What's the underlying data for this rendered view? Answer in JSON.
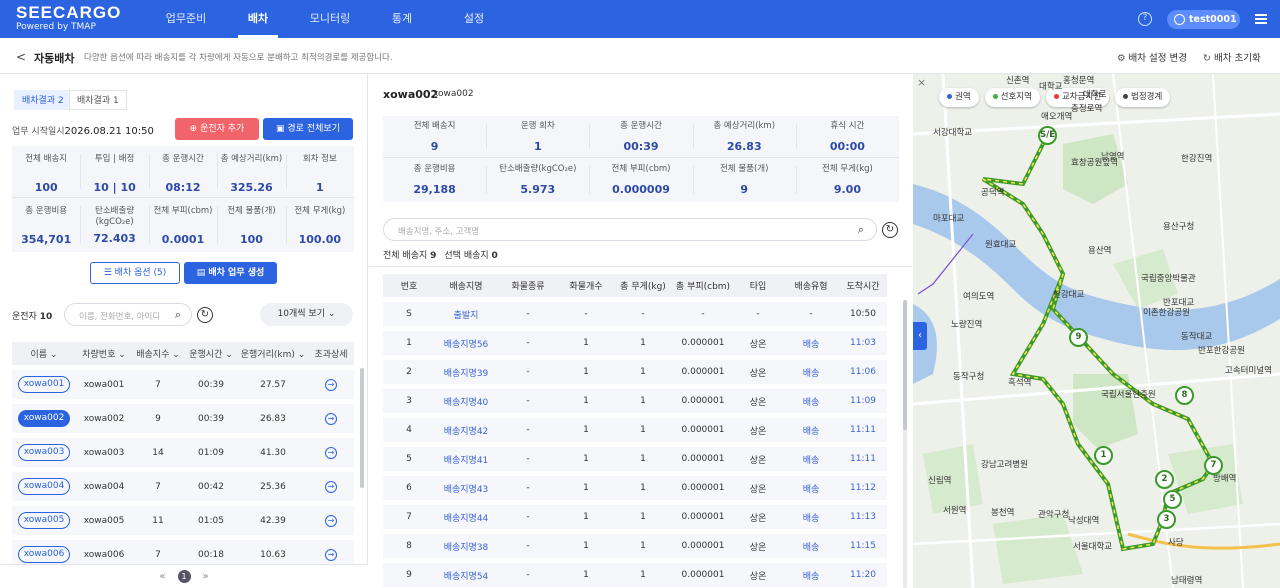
{
  "brand": {
    "logo": "SEECARGO",
    "powered": "Powered by TMAP"
  },
  "nav": [
    "업무준비",
    "배차",
    "모니터링",
    "통계",
    "설정"
  ],
  "user": {
    "name": "test0001"
  },
  "subbar": {
    "back": "<",
    "title": "자동배차",
    "desc": "다양한 옵션에 따라 배송지를 각 차량에게 자동으로 분배하고 최적의경로를 제공합니다.",
    "settings": "배차 설정 변경",
    "reset": "배차 초기화"
  },
  "left": {
    "tabs": [
      "배차결과 2",
      "배차결과 1"
    ],
    "start_label": "업무 시작일시",
    "start_value": "2026.08.21 10:50",
    "add_driver": "운전자 추가",
    "route_all": "경로 전체보기",
    "stats_row1": [
      {
        "label": "전체 배송지",
        "value": "100"
      },
      {
        "label": "투입 | 배정",
        "value": "10 | 10"
      },
      {
        "label": "총 운행시간",
        "value": "08:12"
      },
      {
        "label": "총 예상거리(km)",
        "value": "325.26"
      },
      {
        "label": "회차 정보",
        "value": "1"
      }
    ],
    "stats_row2": [
      {
        "label": "총 운행비용",
        "value": "354,701"
      },
      {
        "label": "탄소배출량 (kgCO₂e)",
        "value": "72.403"
      },
      {
        "label": "전체 부피(cbm)",
        "value": "0.0001"
      },
      {
        "label": "전체 물품(개)",
        "value": "100"
      },
      {
        "label": "전체 무게(kg)",
        "value": "100.00"
      }
    ],
    "option_btn": "배차 옵션 (5)",
    "generate_btn": "배차 업무 생성",
    "driver_label": "운전자",
    "driver_count": "10",
    "search_placeholder": "이름, 전화번호, 아이디",
    "per_page": "10개씩 보기",
    "columns": [
      "이름",
      "차량번호",
      "배송지수",
      "운행시간",
      "운행거리(km)",
      "초과상세"
    ],
    "rows": [
      {
        "name": "xowa001",
        "car": "xowa001",
        "stops": "7",
        "time": "00:39",
        "dist": "27.57"
      },
      {
        "name": "xowa002",
        "car": "xowa002",
        "stops": "9",
        "time": "00:39",
        "dist": "26.83"
      },
      {
        "name": "xowa003",
        "car": "xowa003",
        "stops": "14",
        "time": "01:09",
        "dist": "41.30"
      },
      {
        "name": "xowa004",
        "car": "xowa004",
        "stops": "7",
        "time": "00:42",
        "dist": "25.36"
      },
      {
        "name": "xowa005",
        "car": "xowa005",
        "stops": "11",
        "time": "01:05",
        "dist": "42.39"
      },
      {
        "name": "xowa006",
        "car": "xowa006",
        "stops": "7",
        "time": "00:18",
        "dist": "10.63"
      }
    ],
    "selected_row": 1,
    "page": "1"
  },
  "middle": {
    "title": "xowa002",
    "subtitle": "xowa002",
    "stats_row1": [
      {
        "label": "전체 배송지",
        "value": "9"
      },
      {
        "label": "운행 회차",
        "value": "1"
      },
      {
        "label": "총 운행시간",
        "value": "00:39"
      },
      {
        "label": "총 예상거리(km)",
        "value": "26.83"
      },
      {
        "label": "휴식 시간",
        "value": "00:00"
      }
    ],
    "stats_row2": [
      {
        "label": "총 운행비용",
        "value": "29,188"
      },
      {
        "label": "탄소배출량(kgCO₂e)",
        "value": "5.973"
      },
      {
        "label": "전체 부피(cbm)",
        "value": "0.000009"
      },
      {
        "label": "전체 물품(개)",
        "value": "9"
      },
      {
        "label": "전체 무게(kg)",
        "value": "9.00"
      }
    ],
    "search_placeholder": "배송지명, 주소, 고객명",
    "total_label": "전체 배송지",
    "total_value": "9",
    "selected_label": "선택 배송지",
    "selected_value": "0",
    "columns": [
      "번호",
      "배송지명",
      "화물종류",
      "화물개수",
      "총 무게(kg)",
      "총 부피(cbm)",
      "타입",
      "배송유형",
      "도착시간"
    ],
    "rows": [
      [
        "S",
        "출발지",
        "-",
        "-",
        "-",
        "-",
        "-",
        "-",
        "10:50"
      ],
      [
        "1",
        "배송지명56",
        "-",
        "1",
        "1",
        "0.000001",
        "상온",
        "배송",
        "11:03"
      ],
      [
        "2",
        "배송지명39",
        "-",
        "1",
        "1",
        "0.000001",
        "상온",
        "배송",
        "11:06"
      ],
      [
        "3",
        "배송지명40",
        "-",
        "1",
        "1",
        "0.000001",
        "상온",
        "배송",
        "11:09"
      ],
      [
        "4",
        "배송지명42",
        "-",
        "1",
        "1",
        "0.000001",
        "상온",
        "배송",
        "11:11"
      ],
      [
        "5",
        "배송지명41",
        "-",
        "1",
        "1",
        "0.000001",
        "상온",
        "배송",
        "11:11"
      ],
      [
        "6",
        "배송지명43",
        "-",
        "1",
        "1",
        "0.000001",
        "상온",
        "배송",
        "11:12"
      ],
      [
        "7",
        "배송지명44",
        "-",
        "1",
        "1",
        "0.000001",
        "상온",
        "배송",
        "11:13"
      ],
      [
        "8",
        "배송지명38",
        "-",
        "1",
        "1",
        "0.000001",
        "상온",
        "배송",
        "11:15"
      ],
      [
        "9",
        "배송지명54",
        "-",
        "1",
        "1",
        "0.000001",
        "상온",
        "배송",
        "11:20"
      ]
    ]
  },
  "map": {
    "chips": [
      {
        "label": "권역",
        "color": "#2b63e0"
      },
      {
        "label": "선호지역",
        "color": "#3cb043"
      },
      {
        "label": "교차금지선",
        "color": "#e53935"
      },
      {
        "label": "법정경계",
        "color": "#444444"
      }
    ],
    "labels": [
      "신촌역",
      "홍청문역",
      "대학교",
      "애오개역",
      "충정로역",
      "효창공원앞역",
      "남영역",
      "용산구청",
      "한강진역",
      "국립중앙박물관",
      "이촌한강공원",
      "동작대교",
      "반포한강공원",
      "노량진역",
      "동작구청",
      "흑석역",
      "국립서울현충원",
      "고속터미널역",
      "방배역",
      "관악구청",
      "낙성대역",
      "사당",
      "서울대학교",
      "봉천역",
      "신림역",
      "서원역",
      "강남고려병원",
      "여의도역",
      "원효대교",
      "공덕역",
      "서강대학교",
      "마포대교",
      "한강대교",
      "용산역",
      "반포대교",
      "남태령역",
      "대학로"
    ],
    "markers": [
      "S/E",
      "1",
      "2",
      "3",
      "5",
      "7",
      "8",
      "9"
    ]
  }
}
